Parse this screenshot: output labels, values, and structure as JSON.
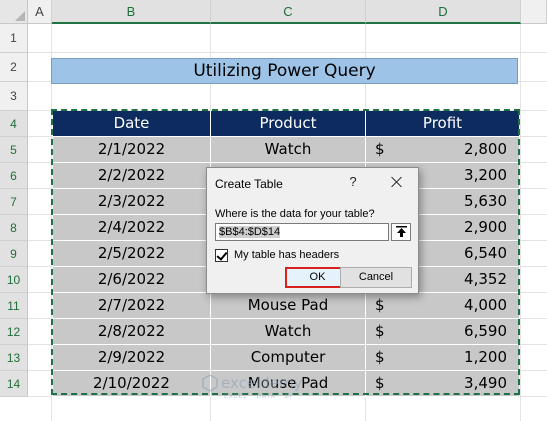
{
  "column_headers": [
    "A",
    "B",
    "C",
    "D"
  ],
  "row_headers": [
    "1",
    "2",
    "3",
    "4",
    "5",
    "6",
    "7",
    "8",
    "9",
    "10",
    "11",
    "12",
    "13",
    "14"
  ],
  "title": "Utilizing Power Query",
  "table": {
    "headers": [
      "Date",
      "Product",
      "Profit"
    ],
    "currency_symbol": "$",
    "rows": [
      {
        "date": "2/1/2022",
        "product": "Watch",
        "profit": "2,800"
      },
      {
        "date": "2/2/2022",
        "product": "",
        "profit": "3,200"
      },
      {
        "date": "2/3/2022",
        "product": "",
        "profit": "5,630"
      },
      {
        "date": "2/4/2022",
        "product": "",
        "profit": "2,900"
      },
      {
        "date": "2/5/2022",
        "product": "",
        "profit": "6,540"
      },
      {
        "date": "2/6/2022",
        "product": "",
        "profit": "4,352"
      },
      {
        "date": "2/7/2022",
        "product": "Mouse Pad",
        "profit": "4,000"
      },
      {
        "date": "2/8/2022",
        "product": "Watch",
        "profit": "6,590"
      },
      {
        "date": "2/9/2022",
        "product": "Computer",
        "profit": "1,200"
      },
      {
        "date": "2/10/2022",
        "product": "Mouse Pad",
        "profit": "3,490"
      }
    ]
  },
  "dialog": {
    "title": "Create Table",
    "help": "?",
    "prompt": "Where is the data for your table?",
    "range_value": "$B$4:$D$14",
    "headers_checkbox_label": "My table has headers",
    "headers_checked": true,
    "ok_label": "OK",
    "cancel_label": "Cancel"
  },
  "watermark": {
    "name": "exceldemy",
    "tagline": "EXCEL · DATA · BI"
  },
  "colors": {
    "header_fill": "#0d2b5e",
    "body_fill": "#c8c8c8",
    "title_fill": "#9dc3e6",
    "marquee": "#1e7145",
    "ok_highlight": "#d9221e"
  }
}
